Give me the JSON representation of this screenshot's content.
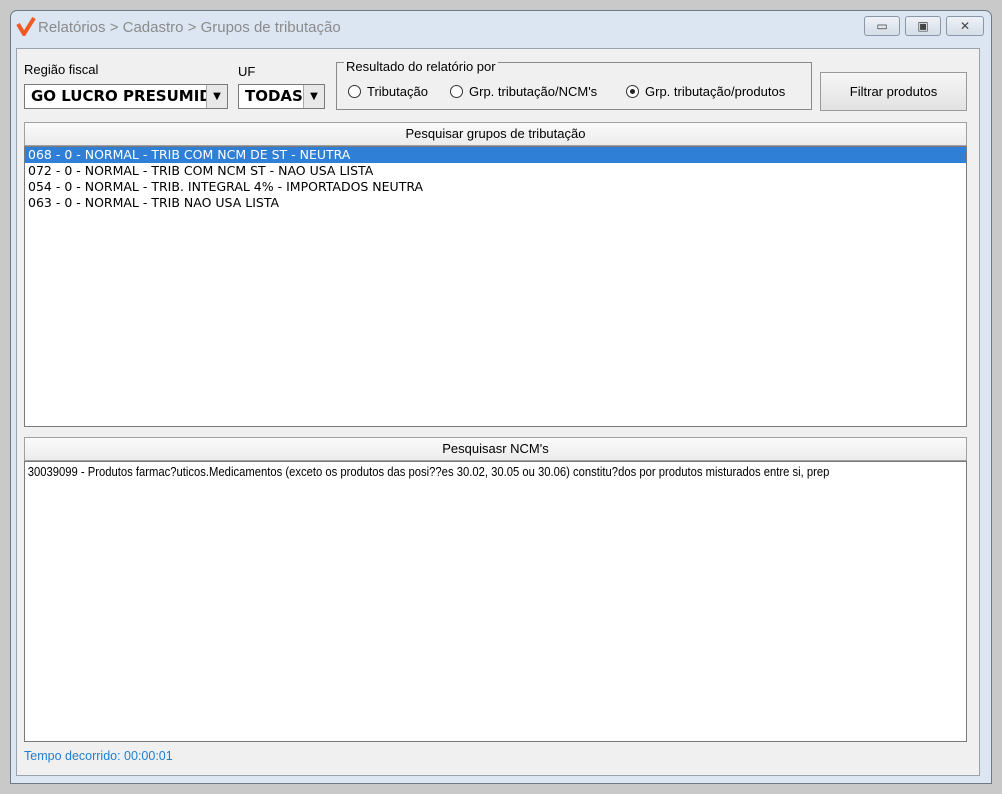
{
  "window": {
    "title": "Relatórios > Cadastro > Grupos de tributação",
    "minimize": "▭",
    "maximize": "▣",
    "close": "✕"
  },
  "filters": {
    "regiao_label": "Região fiscal",
    "regiao_value": "GO LUCRO PRESUMIDO",
    "uf_label": "UF",
    "uf_value": "TODAS",
    "resultado_caption": "Resultado do relatório por",
    "options": [
      {
        "label": "Tributação",
        "selected": false
      },
      {
        "label": "Grp. tributação/NCM's",
        "selected": false
      },
      {
        "label": "Grp. tributação/produtos",
        "selected": true
      }
    ],
    "filter_button": "Filtrar produtos"
  },
  "grupos": {
    "header": "Pesquisar grupos de tributação",
    "items": [
      "068 - 0 - NORMAL - TRIB COM NCM DE ST - NEUTRA",
      "072 - 0 - NORMAL - TRIB COM NCM ST - NAO USA LISTA",
      "054 - 0 - NORMAL - TRIB. INTEGRAL 4% - IMPORTADOS NEUTRA",
      "063 - 0 - NORMAL - TRIB NAO USA LISTA"
    ]
  },
  "ncms": {
    "header": "Pesquisasr NCM's",
    "items": [
      "30039099 - Produtos farmac?uticos.Medicamentos (exceto os produtos das posi??es 30.02, 30.05 ou 30.06) constitu?dos por produtos misturados entre si, prep"
    ]
  },
  "status": "Tempo decorrido: 00:00:01"
}
